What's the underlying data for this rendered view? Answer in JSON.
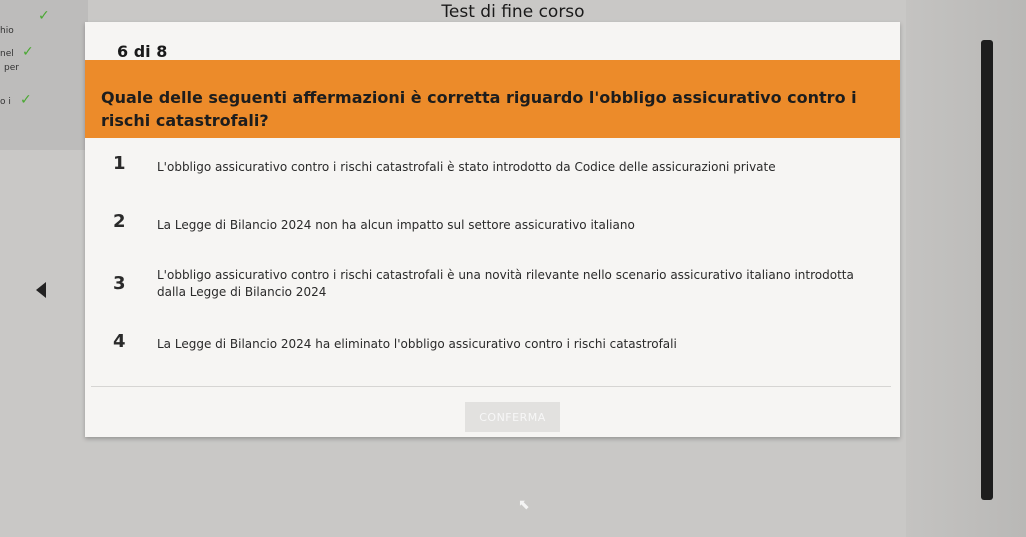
{
  "page": {
    "title": "Test di fine corso"
  },
  "sidebar": {
    "items": [
      {
        "label": "hio"
      },
      {
        "label": "nel"
      },
      {
        "label": "per"
      },
      {
        "label": "o i"
      }
    ]
  },
  "question": {
    "counter": "6 di 8",
    "text": "Quale delle seguenti affermazioni è corretta riguardo l'obbligo assicurativo contro i rischi catastrofali?"
  },
  "options": [
    {
      "num": "1",
      "text": "L'obbligo assicurativo contro i rischi catastrofali è stato introdotto da Codice delle assicurazioni private"
    },
    {
      "num": "2",
      "text": "La Legge di Bilancio 2024 non ha alcun impatto sul settore assicurativo italiano"
    },
    {
      "num": "3",
      "text": "L'obbligo assicurativo contro i rischi catastrofali è una novità rilevante nello scenario assicurativo italiano introdotta dalla Legge di Bilancio 2024"
    },
    {
      "num": "4",
      "text": "La Legge di Bilancio 2024 ha eliminato l'obbligo assicurativo contro i rischi catastrofali"
    }
  ],
  "actions": {
    "confirm_label": "CONFERMA"
  },
  "colors": {
    "accent": "#ec8b2a",
    "check": "#4aa832"
  }
}
